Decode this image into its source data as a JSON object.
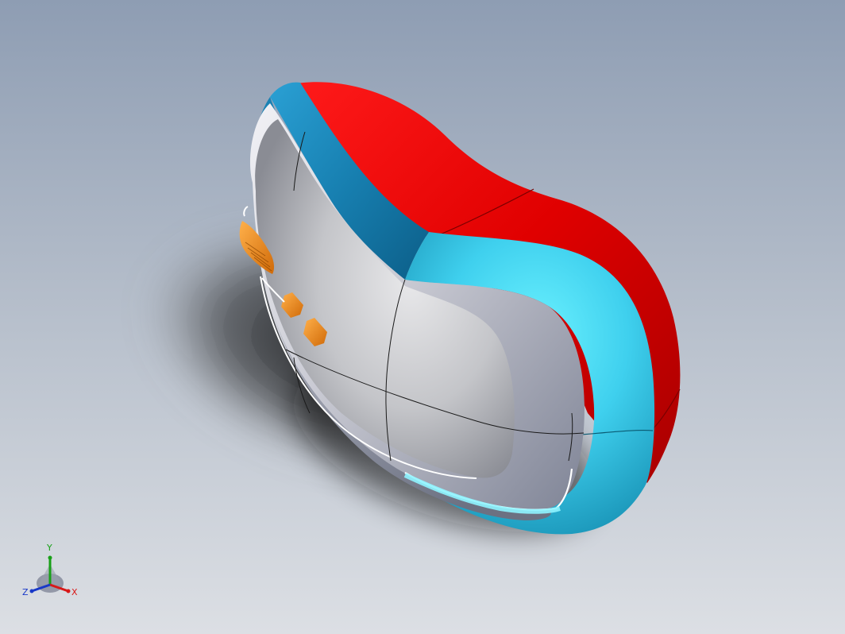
{
  "viewport": {
    "colors": {
      "background_top": "#8e9db3",
      "background_bottom": "#dcdfe4",
      "red_shell": "#e00000",
      "blue_band": "#1a82b4",
      "cyan_band": "#3fd0ee",
      "grey_face": "#c8cad3",
      "orange_buttons": "#f08a1a"
    }
  },
  "triad": {
    "y_label": "Y",
    "x_label": "X",
    "z_label": "Z",
    "colors": {
      "x": "#d81818",
      "y": "#18a018",
      "z": "#1838c8"
    }
  }
}
